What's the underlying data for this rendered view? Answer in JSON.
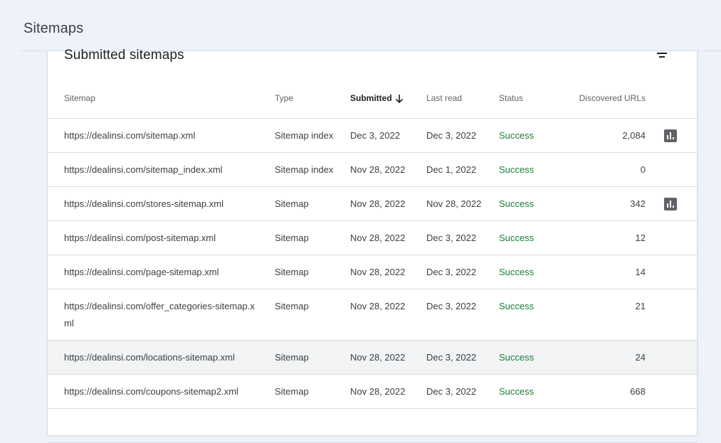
{
  "header": {
    "title": "Sitemaps"
  },
  "card": {
    "title": "Submitted sitemaps",
    "filter_icon": "filter-icon"
  },
  "columns": {
    "sitemap": "Sitemap",
    "type": "Type",
    "submitted": "Submitted",
    "last_read": "Last read",
    "status": "Status",
    "discovered": "Discovered URLs"
  },
  "sort": {
    "column": "submitted",
    "direction": "descending",
    "icon": "arrow-down-icon"
  },
  "status_color": "#188038",
  "rows": [
    {
      "sitemap": "https://dealinsi.com/sitemap.xml",
      "type": "Sitemap index",
      "submitted": "Dec 3, 2022",
      "last_read": "Dec 3, 2022",
      "status": "Success",
      "discovered": "2,084",
      "chart_icon": "bar-chart-icon"
    },
    {
      "sitemap": "https://dealinsi.com/sitemap_index.xml",
      "type": "Sitemap index",
      "submitted": "Nov 28, 2022",
      "last_read": "Dec 1, 2022",
      "status": "Success",
      "discovered": "0"
    },
    {
      "sitemap": "https://dealinsi.com/stores-sitemap.xml",
      "type": "Sitemap",
      "submitted": "Nov 28, 2022",
      "last_read": "Nov 28, 2022",
      "status": "Success",
      "discovered": "342",
      "chart_icon": "bar-chart-icon"
    },
    {
      "sitemap": "https://dealinsi.com/post-sitemap.xml",
      "type": "Sitemap",
      "submitted": "Nov 28, 2022",
      "last_read": "Dec 3, 2022",
      "status": "Success",
      "discovered": "12"
    },
    {
      "sitemap": "https://dealinsi.com/page-sitemap.xml",
      "type": "Sitemap",
      "submitted": "Nov 28, 2022",
      "last_read": "Dec 3, 2022",
      "status": "Success",
      "discovered": "14"
    },
    {
      "sitemap": "https://dealinsi.com/offer_categories-sitemap.xml",
      "type": "Sitemap",
      "submitted": "Nov 28, 2022",
      "last_read": "Dec 3, 2022",
      "status": "Success",
      "discovered": "21"
    },
    {
      "sitemap": "https://dealinsi.com/locations-sitemap.xml",
      "type": "Sitemap",
      "submitted": "Nov 28, 2022",
      "last_read": "Dec 3, 2022",
      "status": "Success",
      "discovered": "24",
      "hovered": true
    },
    {
      "sitemap": "https://dealinsi.com/coupons-sitemap2.xml",
      "type": "Sitemap",
      "submitted": "Nov 28, 2022",
      "last_read": "Dec 3, 2022",
      "status": "Success",
      "discovered": "668"
    }
  ]
}
